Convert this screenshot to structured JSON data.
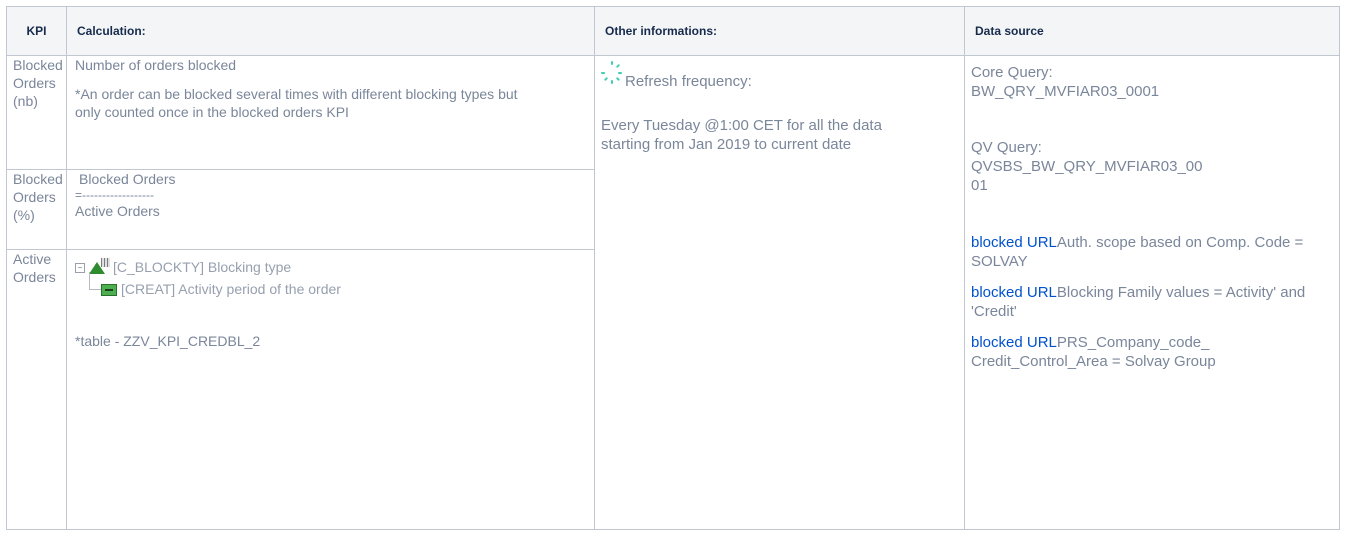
{
  "headers": {
    "kpi": "KPI",
    "calculation": "Calculation:",
    "other": "Other informations:",
    "source": "Data source"
  },
  "rows": [
    {
      "kpi": [
        "Blocked",
        "Orders",
        "(nb)"
      ],
      "calc_main": "Number of orders blocked",
      "calc_note": "*An order can be blocked several times with different blocking types but only counted once in the blocked orders KPI"
    },
    {
      "kpi": [
        "Blocked",
        "Orders",
        "(%)"
      ],
      "numerator": "Blocked Orders",
      "divider": "=------------------",
      "denominator": "Active Orders"
    },
    {
      "kpi": [
        "Active",
        "Orders"
      ],
      "tree_line1": "[C_BLOCKTY] Blocking type",
      "tree_line2": "[CREAT] Activity period of the order",
      "table_note": "*table - ZZV_KPI_CREDBL_2"
    }
  ],
  "other": {
    "refresh_label": "Refresh frequency:",
    "refresh_detail": "Every Tuesday @1:00 CET for all the data starting from Jan 2019 to current date"
  },
  "source": {
    "core_label": "Core Query:",
    "core_value": "BW_QRY_MVFIAR03_0001",
    "qv_label": "QV Query:",
    "qv_value_1": "QVSBS_BW_QRY_MVFIAR03_00",
    "qv_value_2": "01",
    "filters": [
      {
        "link": "blocked URL",
        "text": "Auth. scope based on Comp. Code = SOLVAY"
      },
      {
        "link": "blocked URL",
        "text": "Blocking Family values = Activity' and 'Credit'"
      },
      {
        "link": "blocked URL",
        "text": "PRS_Company_code_ Credit_Control_Area = Solvay Group"
      }
    ]
  },
  "colors": {
    "text": "#7a869a",
    "header_bg": "#f4f5f7",
    "border": "#c1c7d0",
    "link": "#0052cc"
  }
}
